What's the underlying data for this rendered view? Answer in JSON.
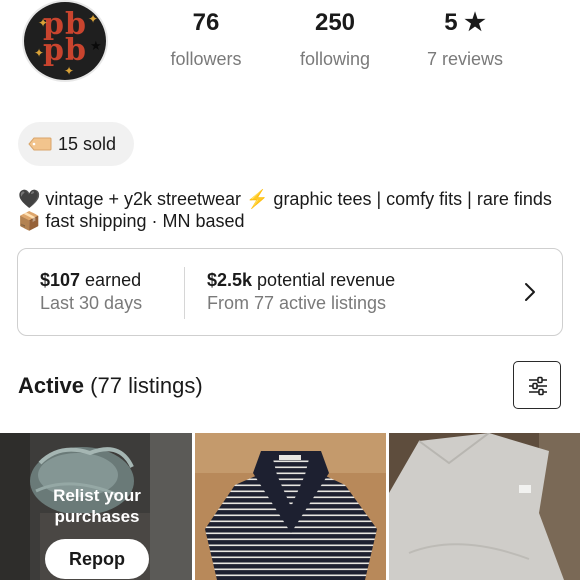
{
  "profile": {
    "avatar_text": [
      "pb",
      "pb"
    ],
    "stats": [
      {
        "value": "76",
        "label": "followers"
      },
      {
        "value": "250",
        "label": "following"
      },
      {
        "value": "5 ★",
        "label": "7 reviews"
      }
    ],
    "sold": "15 sold",
    "bio": "🖤 vintage + y2k streetwear ⚡ graphic tees | comfy fits | rare finds 📦 fast shipping · MN based"
  },
  "earnings": {
    "earned_amount": "$107",
    "earned_label": " earned",
    "earned_period": "Last 30 days",
    "potential_amount": "$2.5k",
    "potential_label": " potential revenue",
    "potential_sub": "From 77 active listings"
  },
  "listings": {
    "heading": "Active",
    "count": " (77 listings)",
    "relist_line1": "Relist your",
    "relist_line2": "purchases",
    "repop_label": "Repop"
  },
  "icons": {
    "tag": "price-tag-icon",
    "chevron": "chevron-right-icon",
    "filter": "sliders-icon"
  },
  "colors": {
    "avatar_bg": "#1f1f1f",
    "avatar_text": "#c9442e",
    "muted_text": "#7a7a7a",
    "pill_bg": "#f1f1f1"
  }
}
